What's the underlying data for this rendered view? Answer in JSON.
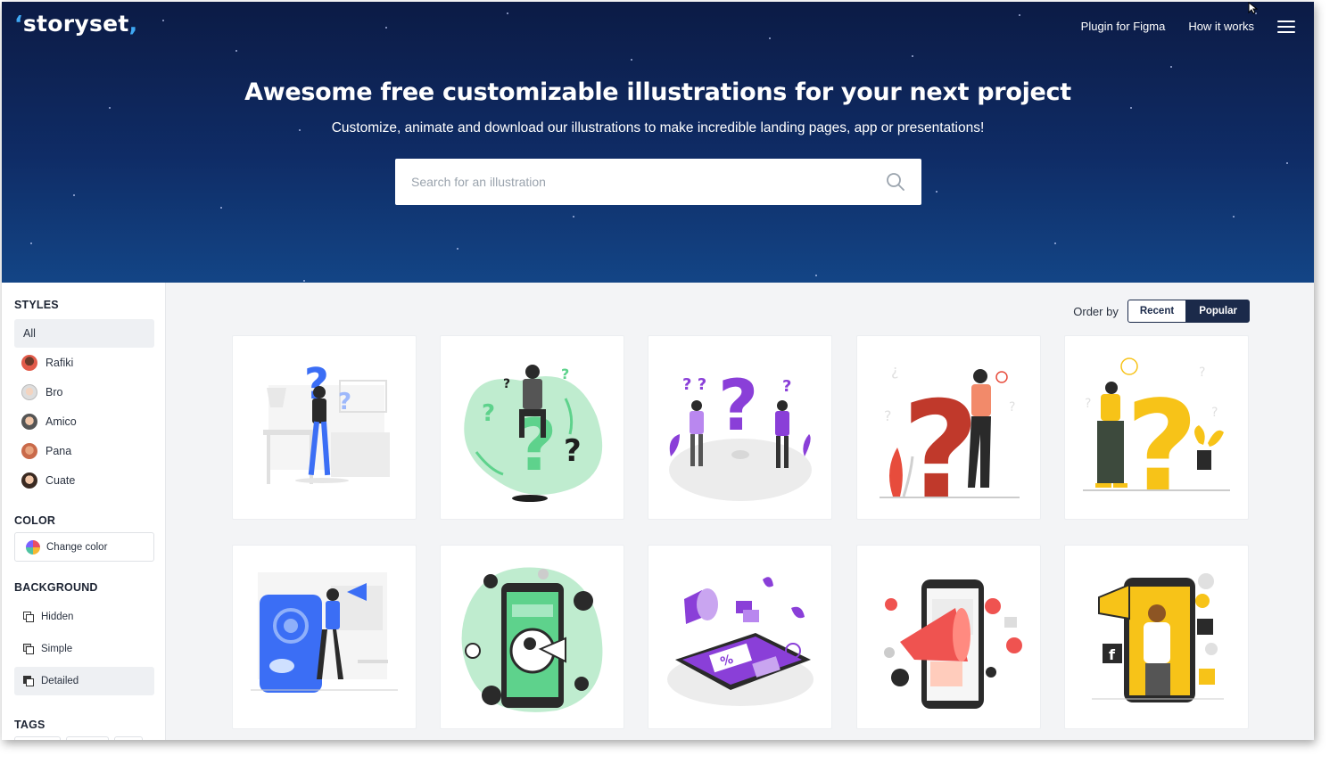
{
  "header": {
    "logo": "storyset",
    "nav": [
      {
        "label": "Plugin for Figma"
      },
      {
        "label": "How it works"
      }
    ]
  },
  "hero": {
    "title": "Awesome free customizable illustrations for your next project",
    "subtitle": "Customize, animate and download our illustrations to make incredible landing pages, app or presentations!",
    "search_placeholder": "Search for an illustration"
  },
  "sidebar": {
    "styles_heading": "STYLES",
    "styles": [
      {
        "label": "All"
      },
      {
        "label": "Rafiki"
      },
      {
        "label": "Bro"
      },
      {
        "label": "Amico"
      },
      {
        "label": "Pana"
      },
      {
        "label": "Cuate"
      }
    ],
    "color_heading": "COLOR",
    "change_color_label": "Change color",
    "background_heading": "BACKGROUND",
    "backgrounds": [
      {
        "label": "Hidden"
      },
      {
        "label": "Simple"
      },
      {
        "label": "Detailed"
      }
    ],
    "tags_heading": "TAGS"
  },
  "order": {
    "label": "Order by",
    "recent": "Recent",
    "popular": "Popular"
  },
  "colors": {
    "hero_top": "#0c1b45",
    "hero_bottom": "#134586",
    "accent_dark": "#1b2a4a",
    "illustration_blue": "#3b6ef5",
    "illustration_green": "#5ed28c",
    "illustration_purple": "#8a3fd8",
    "illustration_red": "#c0392b",
    "illustration_yellow": "#f7c318",
    "illustration_coral": "#ef5350"
  }
}
